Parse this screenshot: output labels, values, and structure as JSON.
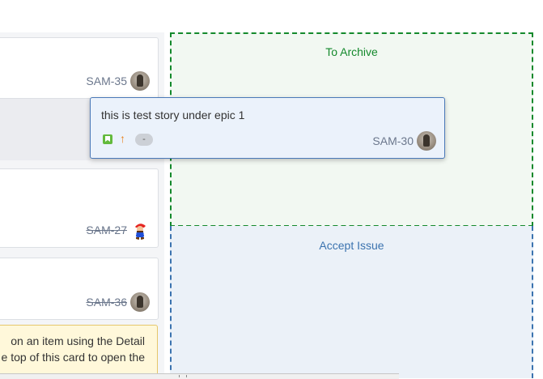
{
  "cards": [
    {
      "key": "SAM-35",
      "done": false,
      "avatar": "man-avatar"
    },
    {
      "key": "SAM-27",
      "done": true,
      "avatar": "mario-avatar"
    },
    {
      "key": "SAM-36",
      "done": true,
      "avatar": "man-avatar"
    }
  ],
  "drop_zones": {
    "archive_label": "To Archive",
    "accept_label": "Accept Issue",
    "archive_color": "#14892c",
    "accept_color": "#3b73af"
  },
  "dragged_card": {
    "summary": "this is test story under epic 1",
    "key": "SAM-30",
    "issue_type_icon": "story-icon",
    "priority_icon": "arrow-up-icon",
    "estimate": "-",
    "avatar": "man-avatar"
  },
  "tip": {
    "line1": "on an item using the Detail",
    "line2": "e top of this card to open the"
  }
}
